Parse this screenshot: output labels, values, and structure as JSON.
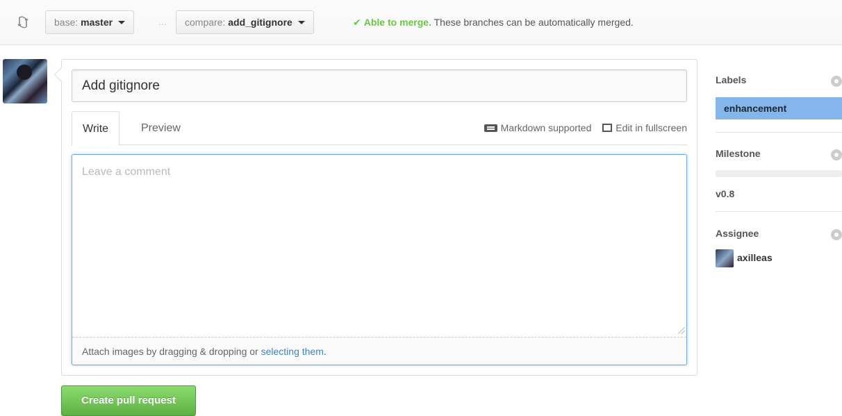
{
  "compare": {
    "base_kind": "base:",
    "base_branch": "master",
    "separator": "…",
    "compare_kind": "compare:",
    "compare_branch": "add_gitignore",
    "merge_ok": "Able to merge.",
    "merge_message": "These branches can be automatically merged."
  },
  "form": {
    "title_value": "Add gitignore",
    "tabs": [
      "Write",
      "Preview"
    ],
    "markdown_label": "Markdown supported",
    "fullscreen_label": "Edit in fullscreen",
    "comment_placeholder": "Leave a comment",
    "attach_text": "Attach images by dragging & dropping or ",
    "attach_link": "selecting them",
    "attach_suffix": "."
  },
  "submit": {
    "label": "Create pull request"
  },
  "sidebar": {
    "labels_title": "Labels",
    "label_name": "enhancement",
    "label_color": "#84b6eb",
    "milestone_title": "Milestone",
    "milestone_name": "v0.8",
    "assignee_title": "Assignee",
    "assignee_name": "axilleas"
  },
  "colors": {
    "merge_ok": "#6cc644",
    "primary_button": "#60b044",
    "link": "#4183c4",
    "focus_border": "#6fa8dc"
  },
  "icons": [
    "compare-icon",
    "caret-down-icon",
    "check-icon",
    "markdown-icon",
    "fullscreen-icon",
    "gear-icon",
    "resize-grip-icon"
  ]
}
